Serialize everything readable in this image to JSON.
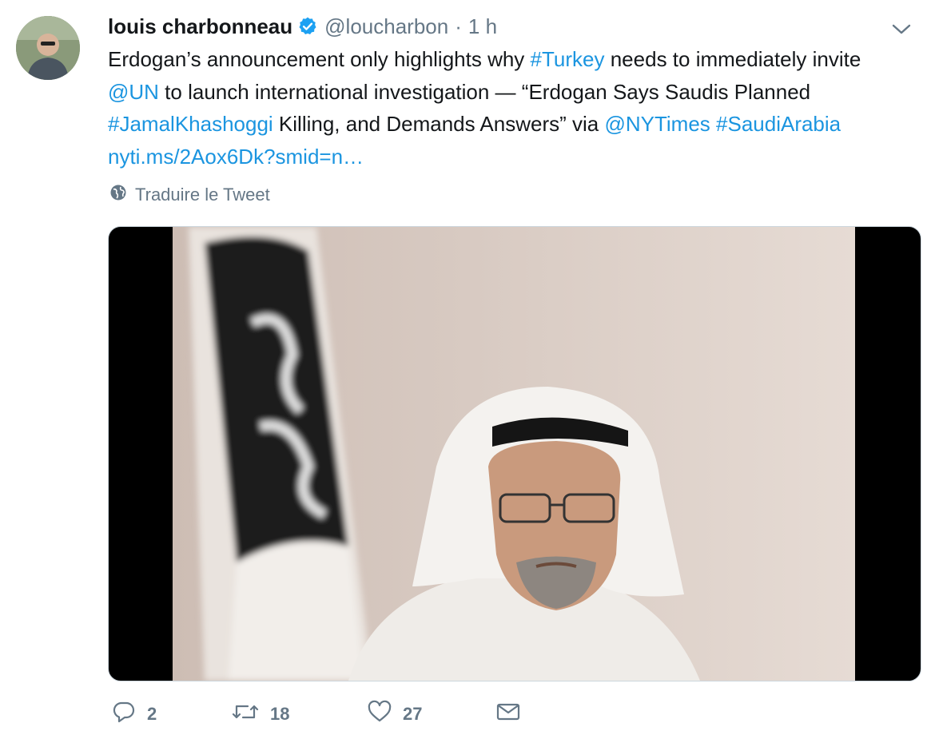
{
  "tweet": {
    "author_name": "louis charbonneau",
    "handle": "@loucharbon",
    "separator": "·",
    "time": "1 h",
    "text": [
      {
        "t": "Erdogan’s announcement only highlights why ",
        "link": false
      },
      {
        "t": "#Turkey",
        "link": true
      },
      {
        "t": " needs to immediately invite ",
        "link": false
      },
      {
        "t": "@UN",
        "link": true
      },
      {
        "t": " to launch international investigation — “Erdogan Says Saudis Planned ",
        "link": false
      },
      {
        "t": "#JamalKhashoggi",
        "link": true
      },
      {
        "t": " Killing, and Demands Answers” via ",
        "link": false
      },
      {
        "t": "@NYTimes",
        "link": true
      },
      {
        "t": " ",
        "link": false
      },
      {
        "t": "#SaudiArabia",
        "link": true
      },
      {
        "t": " ",
        "link": false
      },
      {
        "t": "nyti.ms/2Aox6Dk?smid=n…",
        "link": true
      }
    ],
    "translate_label": "Traduire le Tweet",
    "media_icon": "photo",
    "actions": {
      "reply_count": "2",
      "retweet_count": "18",
      "like_count": "27"
    }
  },
  "icons": {
    "verified": "verified-badge-icon",
    "caret": "chevron-down-icon",
    "translate": "globe-icon",
    "reply": "reply-icon",
    "retweet": "retweet-icon",
    "like": "heart-icon",
    "dm": "mail-icon"
  },
  "colors": {
    "link": "#1b95e0",
    "secondary": "#657786",
    "text": "#14171a"
  }
}
